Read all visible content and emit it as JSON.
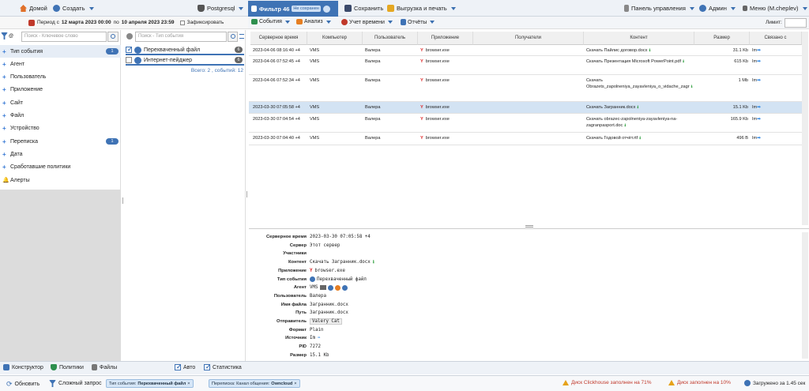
{
  "topbar": {
    "home": "Домой",
    "create": "Создать",
    "db": "Postgresql",
    "filter_tab": "Фильтр 46",
    "filter_badge": "Не сохранен",
    "save": "Сохранить",
    "export": "Выгрузка и печать",
    "dashboard": "Панель управления",
    "admin": "Админ",
    "user_menu": "Меню (M.cheplev)"
  },
  "periodbar": {
    "prefix": "Период с",
    "from": "12 марта 2023 00:00",
    "mid": "по",
    "to": "10 апреля 2023 23:59",
    "fixed": "Зафиксировать"
  },
  "toolbar": {
    "events": "События",
    "analysis": "Анализ",
    "timeline": "Учет времени",
    "reports": "Отчёты",
    "limit": "Лимит:"
  },
  "left": {
    "search_placeholder": "Поиск - Ключевое слово",
    "items": [
      {
        "label": "Тип события",
        "badge": "1"
      },
      {
        "label": "Агент"
      },
      {
        "label": "Пользователь"
      },
      {
        "label": "Приложение"
      },
      {
        "label": "Сайт"
      },
      {
        "label": "Файл"
      },
      {
        "label": "Устройство"
      },
      {
        "label": "Переписка",
        "badge": "1"
      },
      {
        "label": "Дата"
      },
      {
        "label": "Сработавшие политики"
      },
      {
        "label": "Алерты"
      }
    ]
  },
  "middle": {
    "search_placeholder": "Поиск - Тип события",
    "items": [
      {
        "label": "Перехваченный файл",
        "count": "6"
      },
      {
        "label": "Интернет-пейджер",
        "count": "6"
      }
    ],
    "summary": "Всего: 2 , событий: 12"
  },
  "table": {
    "headers": [
      "Серверное время",
      "Компьютер",
      "Пользователь",
      "Приложение",
      "Получатели",
      "Контент",
      "Размер",
      "Связано с"
    ],
    "rows": [
      {
        "time": "2023-04-06 08:16:40 +4",
        "pc": "VMS",
        "user": "Валера",
        "app": "browser.exe",
        "content": "Скачать Пайлис договор.docx",
        "size": "31.1 Kb",
        "link": "Im"
      },
      {
        "time": "2023-04-06 07:52:45 +4",
        "pc": "VMS",
        "user": "Валера",
        "app": "browser.exe",
        "content": "Скачать Презентация Microsoft PowerPoint.pdf",
        "size": "615 Kb",
        "link": "Im"
      },
      {
        "time": "2023-04-06 07:52:34 +4",
        "pc": "VMS",
        "user": "Валера",
        "app": "browser.exe",
        "content": "Скачать Obrazets_zapolneniya_zayavleniya_o_vidache_zagr",
        "size": "1 Mb",
        "link": "Im"
      },
      {
        "time": "2023-03-30 07:05:58 +4",
        "pc": "VMS",
        "user": "Валера",
        "app": "browser.exe",
        "content": "Скачать Загранник.docx",
        "size": "15.1 Kb",
        "link": "Im"
      },
      {
        "time": "2023-03-30 07:04:54 +4",
        "pc": "VMS",
        "user": "Валера",
        "app": "browser.exe",
        "content": "Скачать obrazec-zapolneniya-zayavleniya-na-zagranpasport.doc",
        "size": "165.9 Kb",
        "link": "Im"
      },
      {
        "time": "2023-03-30 07:04:40 +4",
        "pc": "VMS",
        "user": "Валера",
        "app": "browser.exe",
        "content": "Скачать Годовой отчёт.rtf",
        "size": "496 B",
        "link": "Im"
      }
    ]
  },
  "detail": {
    "rows": [
      {
        "k": "Серверное время",
        "v": "2023-03-30 07:05:58 +4"
      },
      {
        "k": "Сервер",
        "v": "Этот сервер"
      },
      {
        "k": "Участники",
        "v": ""
      },
      {
        "k": "Контент",
        "v": "Скачать Загранник.docx"
      },
      {
        "k": "Приложение",
        "v": "browser.exe"
      },
      {
        "k": "Тип события",
        "v": "Перехваченный файл"
      },
      {
        "k": "Агент",
        "v": "VMS"
      },
      {
        "k": "Пользователь",
        "v": "Валера"
      },
      {
        "k": "Имя файла",
        "v": "Загранник.docx"
      },
      {
        "k": "Путь",
        "v": "Загранник.docx"
      },
      {
        "k": "Отправитель",
        "v": "Valery Cat"
      },
      {
        "k": "Формат",
        "v": "Plain"
      },
      {
        "k": "Источник",
        "v": "Im"
      },
      {
        "k": "PID",
        "v": "7272"
      },
      {
        "k": "Размер",
        "v": "15.1 Kb"
      }
    ]
  },
  "bottom": {
    "constructor": "Конструктор",
    "policies": "Политики",
    "files": "Файлы",
    "auto": "Авто",
    "stats": "Статистика",
    "refresh": "Обновить",
    "complex_query": "Сложный запрос",
    "chip1_key": "Тип события:",
    "chip1_val": "Перехваченный файл",
    "chip2_key": "Переписка: Канал общения:",
    "chip2_val": "Owncloud",
    "warn1": "Диск Clickhouse заполнен на 71%",
    "warn2": "Диск заполнен на 10%",
    "loaded": "Загружено за 1.45 сек"
  },
  "colors": {
    "accent": "#3f73b5",
    "selected_row": "#d3e3f3",
    "warning": "#c0392b"
  }
}
